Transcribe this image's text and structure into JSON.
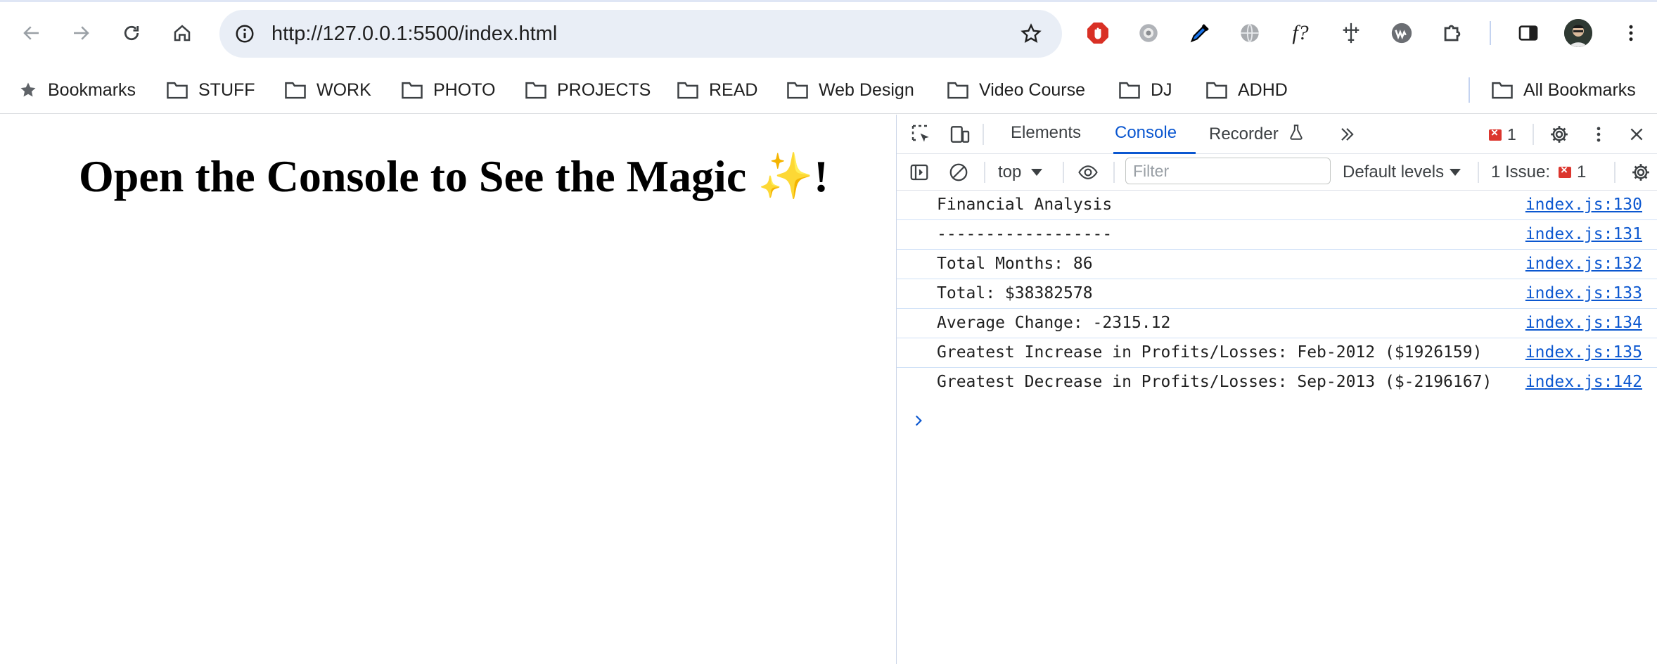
{
  "browser": {
    "url": "http://127.0.0.1:5500/index.html",
    "nav": {
      "back_icon": "arrow-left-icon",
      "forward_icon": "arrow-right-icon",
      "reload_icon": "reload-icon",
      "home_icon": "home-icon"
    },
    "extensions": [
      "adblock-icon",
      "gear-extension-icon",
      "eyedropper-icon",
      "globe-icon",
      "whatfont-icon",
      "dimensions-icon",
      "wappalyzer-icon",
      "puzzle-icon"
    ],
    "accent": "#0b57d0"
  },
  "bookmarks": {
    "star_label": "Bookmarks",
    "folders": [
      "STUFF",
      "WORK",
      "PHOTO",
      "PROJECTS",
      "READ",
      "Web Design",
      "Video Course",
      "DJ",
      "ADHD"
    ],
    "all_label": "All Bookmarks"
  },
  "page": {
    "heading": "Open the Console to See the Magic ",
    "sparkle": "✨",
    "heading_end": "!"
  },
  "devtools": {
    "tabs": [
      "Elements",
      "Console",
      "Recorder"
    ],
    "active_tab": "Console",
    "error_count": "1",
    "context": "top",
    "filter_placeholder": "Filter",
    "levels": "Default levels",
    "issues_label": "1 Issue:",
    "issues_count": "1",
    "error_color": "#dc362e",
    "logs": [
      {
        "message": "Financial Analysis",
        "source": "index.js:130"
      },
      {
        "message": "------------------",
        "source": "index.js:131"
      },
      {
        "message": "Total Months: 86",
        "source": "index.js:132"
      },
      {
        "message": "Total: $38382578",
        "source": "index.js:133"
      },
      {
        "message": "Average Change: -2315.12",
        "source": "index.js:134"
      },
      {
        "message": "Greatest Increase in Profits/Losses: Feb-2012 ($1926159)",
        "source": "index.js:135"
      },
      {
        "message": "Greatest Decrease in Profits/Losses: Sep-2013 ($-2196167)",
        "source": "index.js:142"
      }
    ]
  }
}
